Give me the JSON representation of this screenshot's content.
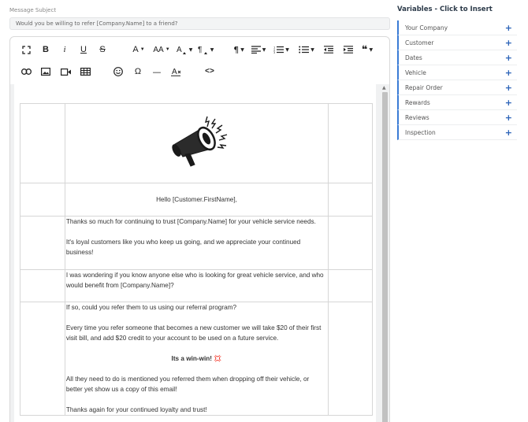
{
  "subject": {
    "label": "Message Subject",
    "value": "Would you be willing to refer [Company.Name] to a friend?"
  },
  "toolbar": {
    "row1": [
      "fullscreen-icon",
      "bold",
      "italic",
      "underline",
      "strikethrough",
      "font-family",
      "font-size",
      "text-color",
      "paragraph-style",
      "paragraph-format",
      "align",
      "ordered-list",
      "unordered-list",
      "outdent",
      "indent",
      "quote"
    ],
    "row2": [
      "link-icon",
      "image-icon",
      "video-icon",
      "table-icon",
      "emoticon-icon",
      "special-characters",
      "horizontal-line",
      "clear-formatting",
      "code-view"
    ],
    "labels": {
      "bold": "B",
      "italic": "i",
      "underline": "U",
      "strike": "S",
      "font_family": "A",
      "font_size": "AA",
      "special_chars": "Ω",
      "hr": "—",
      "code": "<>",
      "quote": "❝",
      "paragraph_format": "¶"
    }
  },
  "email": {
    "greeting": "Hello [Customer.FirstName],",
    "p1": "Thanks so much for continuing to trust [Company.Name] for your vehicle service needs.",
    "p2": "It's loyal customers like you who keep us going, and we appreciate your continued business!",
    "p3": "I was wondering if you know anyone else who is looking for great vehicle service, and who would benefit from [Company.Name]?",
    "p4": "If so, could you refer them to us using our referral program?",
    "p5": "Every time you refer someone that becomes a new customer we will take $20 of their first visit bill, and add $20 credit to your account to be used on a future service.",
    "p6": "Its a win-win! 💢",
    "p7": "All they need to do is mentioned you referred them when dropping off their vehicle, or better yet show us a copy of this email!",
    "p8": "Thanks again for your continued loyalty and trust!"
  },
  "variables": {
    "title": "Variables - Click to Insert",
    "items": [
      {
        "label": "Your Company",
        "action": "+"
      },
      {
        "label": "Customer",
        "action": "+"
      },
      {
        "label": "Dates",
        "action": "+"
      },
      {
        "label": "Vehicle",
        "action": "+"
      },
      {
        "label": "Repair Order",
        "action": "+"
      },
      {
        "label": "Rewards",
        "action": "+"
      },
      {
        "label": "Reviews",
        "action": "+"
      },
      {
        "label": "Inspection",
        "action": "+"
      }
    ],
    "accent_color": "#3a7bd5"
  }
}
